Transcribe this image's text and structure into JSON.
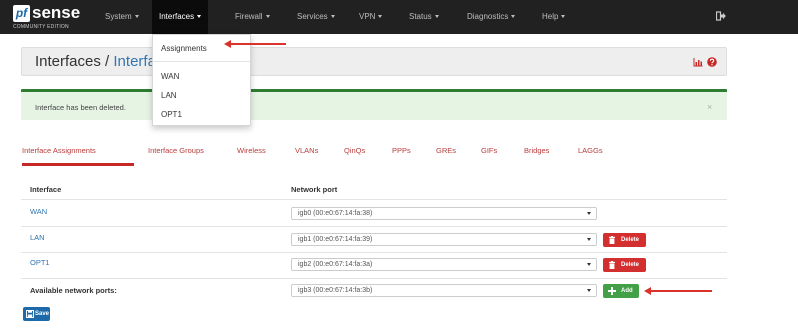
{
  "brand": {
    "logo_mark": "pf",
    "name": "sense",
    "edition": "COMMUNITY EDITION"
  },
  "nav": [
    {
      "label": "System"
    },
    {
      "label": "Interfaces"
    },
    {
      "label": "Firewall"
    },
    {
      "label": "Services"
    },
    {
      "label": "VPN"
    },
    {
      "label": "Status"
    },
    {
      "label": "Diagnostics"
    },
    {
      "label": "Help"
    }
  ],
  "dropdown": {
    "items": [
      "Assignments",
      "WAN",
      "LAN",
      "OPT1"
    ]
  },
  "header": {
    "title": "Interfaces",
    "separator": "/",
    "crumb": "Interfac"
  },
  "alert": {
    "message": "Interface has been deleted.",
    "close": "×"
  },
  "tabs": [
    "Interface Assignments",
    "Interface Groups",
    "Wireless",
    "VLANs",
    "QinQs",
    "PPPs",
    "GREs",
    "GIFs",
    "Bridges",
    "LAGGs"
  ],
  "table": {
    "headers": [
      "Interface",
      "Network port"
    ],
    "rows": [
      {
        "interface": "WAN",
        "port": "igb0 (00:e0:67:14:fa:38)"
      },
      {
        "interface": "LAN",
        "port": "igb1 (00:e0:67:14:fa:39)",
        "action": "Delete"
      },
      {
        "interface": "OPT1",
        "port": "igb2 (00:e0:67:14:fa:3a)",
        "action": "Delete"
      }
    ],
    "available_label": "Available network ports:",
    "available_port": "igb3 (00:e0:67:14:fa:3b)",
    "add_label": "Add"
  },
  "save_label": "Save",
  "colors": {
    "navbar": "#212121",
    "link": "#3276b1",
    "tab": "#b93c3c",
    "danger": "#d32f2f",
    "success": "#43a047",
    "primary": "#1e6aa8",
    "alert_bg": "#e5f4e3",
    "annotation_arrow": "#d9332b"
  }
}
